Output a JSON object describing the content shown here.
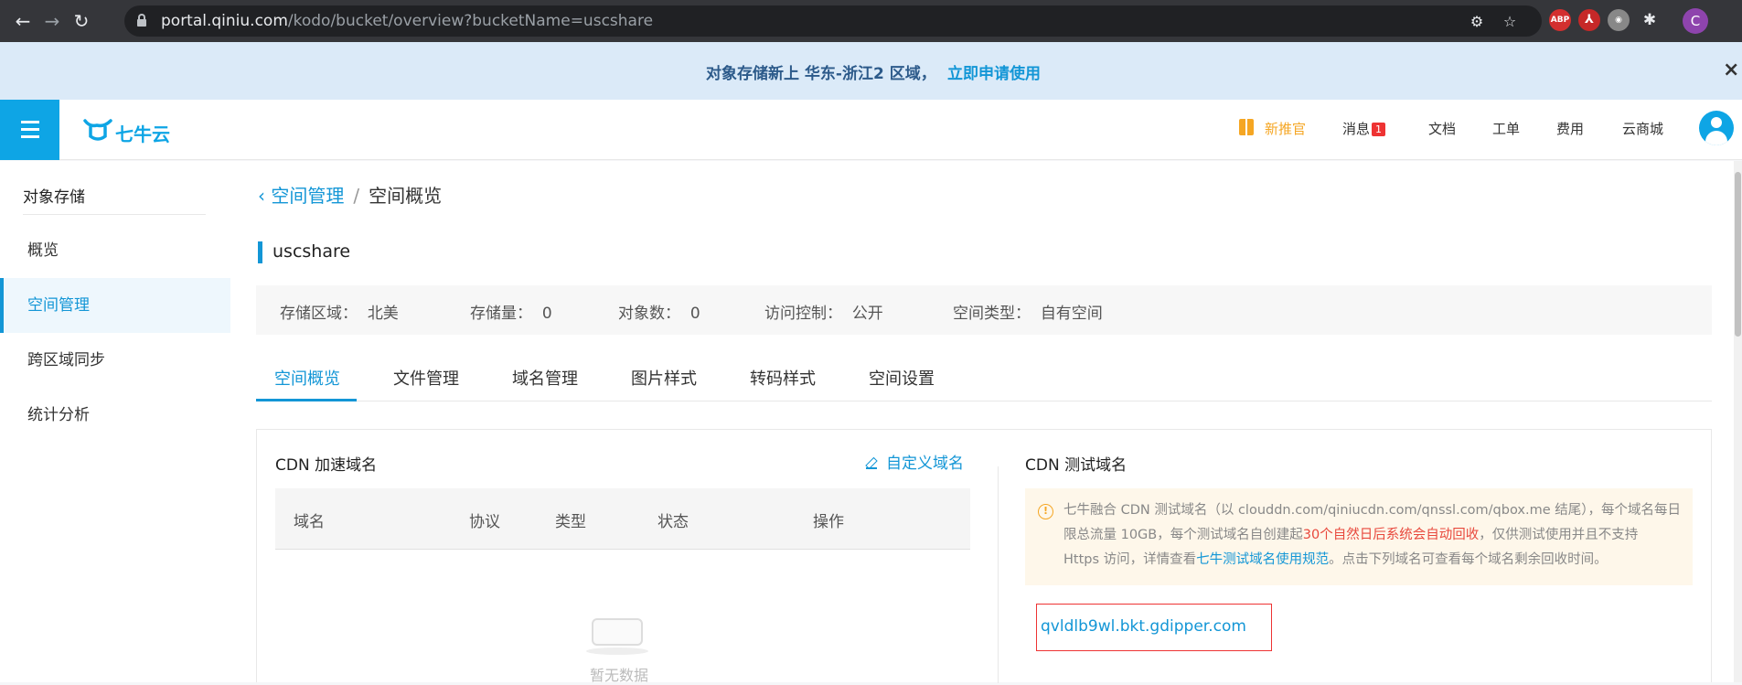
{
  "browser": {
    "url_host": "portal.qiniu.com",
    "url_path": "/kodo/bucket/overview?bucketName=uscshare",
    "profile_initial": "C",
    "extensions": [
      "ABP",
      "Adobe",
      "Sync",
      "Extensions"
    ]
  },
  "promo": {
    "text": "对象存储新上 华东-浙江2 区域，",
    "link": "立即申请使用",
    "close": "×"
  },
  "header": {
    "logo": "七牛云",
    "nav": {
      "new_user": "新推官",
      "messages": "消息",
      "messages_count": "1",
      "docs": "文档",
      "tickets": "工单",
      "billing": "费用",
      "marketplace": "云商城"
    }
  },
  "sidebar": {
    "title": "对象存储",
    "items": [
      {
        "label": "概览"
      },
      {
        "label": "空间管理"
      },
      {
        "label": "跨区域同步"
      },
      {
        "label": "统计分析"
      }
    ]
  },
  "breadcrumb": {
    "back": "空间管理",
    "separator": "/",
    "current": "空间概览"
  },
  "bucket": {
    "name": "uscshare",
    "region_label": "存储区域：",
    "region_value": "北美",
    "storage_label": "存储量：",
    "storage_value": "0",
    "objects_label": "对象数：",
    "objects_value": "0",
    "access_label": "访问控制：",
    "access_value": "公开",
    "type_label": "空间类型：",
    "type_value": "自有空间"
  },
  "tabs": [
    "空间概览",
    "文件管理",
    "域名管理",
    "图片样式",
    "转码样式",
    "空间设置"
  ],
  "cdn": {
    "title": "CDN 加速域名",
    "custom_domain": "自定义域名",
    "columns": [
      "域名",
      "协议",
      "类型",
      "状态",
      "操作"
    ],
    "empty_text": "暂无数据"
  },
  "test_cdn": {
    "title": "CDN 测试域名",
    "notice_line1": "七牛融合 CDN 测试域名（以 clouddn.com/qiniucdn.com/qnssl.com/qbox.me 结尾），每个域名每日",
    "notice_line2a": "限总流量 10GB，每个测试域名自创建起",
    "notice_line2b": "30个自然日后系统会自动回收",
    "notice_line2c": "，仅供测试使用并且不支持",
    "notice_line3a": "Https 访问，详情查看",
    "notice_line3b": "七牛测试域名使用规范",
    "notice_line3c": "。点击下列域名可查看每个域名剩余回收时间。",
    "domain": "qvldlb9wl.bkt.gdipper.com"
  }
}
